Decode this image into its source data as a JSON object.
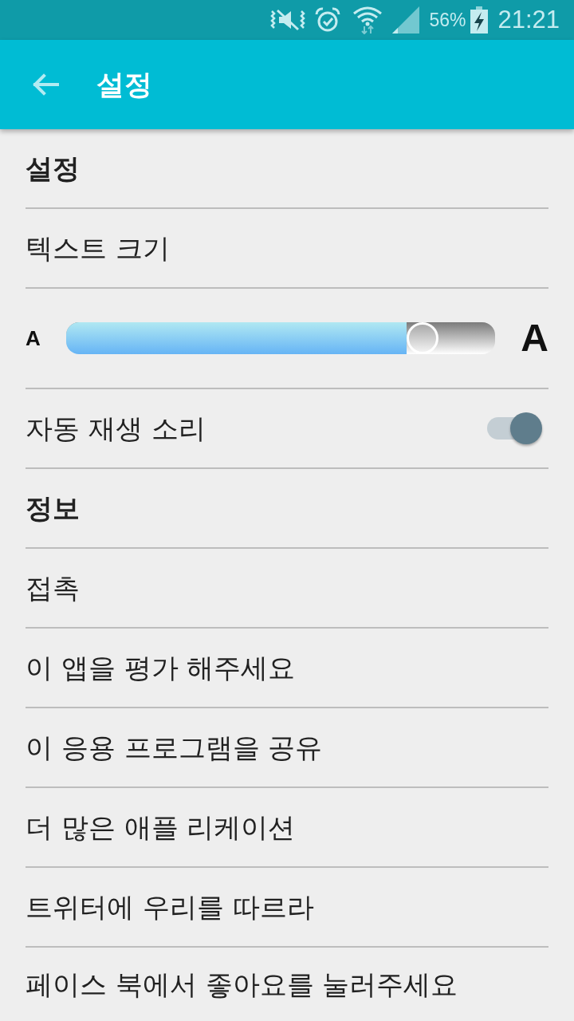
{
  "status_bar": {
    "battery": "56%",
    "time": "21:21"
  },
  "app_bar": {
    "title": "설정"
  },
  "rows": [
    {
      "kind": "header",
      "label": "설정"
    },
    {
      "kind": "item",
      "label": "텍스트 크기"
    },
    {
      "kind": "slider",
      "small_label": "A",
      "large_label": "A",
      "level": 0.83
    },
    {
      "kind": "toggle",
      "label": "자동 재생 소리",
      "on": true
    },
    {
      "kind": "header",
      "label": "정보"
    },
    {
      "kind": "item",
      "label": "접촉"
    },
    {
      "kind": "item",
      "label": "이 앱을 평가 해주세요"
    },
    {
      "kind": "item",
      "label": "이 응용 프로그램을 공유"
    },
    {
      "kind": "item",
      "label": "더 많은 애플 리케이션"
    },
    {
      "kind": "item",
      "label": "트위터에 우리를 따르라"
    },
    {
      "kind": "item",
      "label": "페이스 북에서 좋아요를 눌러주세요"
    }
  ]
}
